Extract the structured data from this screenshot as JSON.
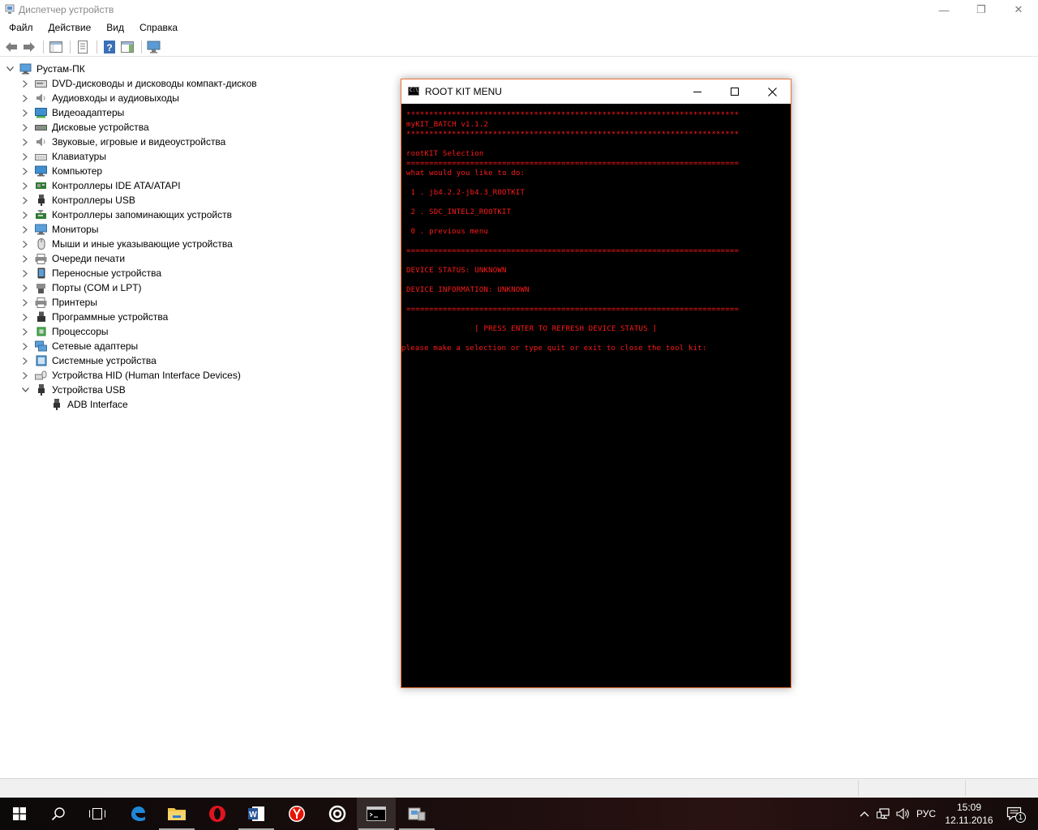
{
  "window": {
    "title": "Диспетчер устройств",
    "caption_min": "—",
    "caption_max": "❐",
    "caption_close": "✕"
  },
  "menu": [
    "Файл",
    "Действие",
    "Вид",
    "Справка"
  ],
  "tree": {
    "root": "Рустам-ПК",
    "items": [
      {
        "label": "DVD-дисководы и дисководы компакт-дисков",
        "icon": "dvd-drive-icon"
      },
      {
        "label": "Аудиовходы и аудиовыходы",
        "icon": "speaker-icon"
      },
      {
        "label": "Видеоадаптеры",
        "icon": "display-adapter-icon"
      },
      {
        "label": "Дисковые устройства",
        "icon": "disk-drive-icon"
      },
      {
        "label": "Звуковые, игровые и видеоустройства",
        "icon": "speaker-icon"
      },
      {
        "label": "Клавиатуры",
        "icon": "keyboard-icon"
      },
      {
        "label": "Компьютер",
        "icon": "computer-icon"
      },
      {
        "label": "Контроллеры IDE ATA/ATAPI",
        "icon": "ide-controller-icon"
      },
      {
        "label": "Контроллеры USB",
        "icon": "usb-plug-icon"
      },
      {
        "label": "Контроллеры запоминающих устройств",
        "icon": "storage-controller-icon"
      },
      {
        "label": "Мониторы",
        "icon": "monitor-icon"
      },
      {
        "label": "Мыши и иные указывающие устройства",
        "icon": "mouse-icon"
      },
      {
        "label": "Очереди печати",
        "icon": "printer-icon"
      },
      {
        "label": "Переносные устройства",
        "icon": "portable-device-icon"
      },
      {
        "label": "Порты (COM и LPT)",
        "icon": "port-icon"
      },
      {
        "label": "Принтеры",
        "icon": "printer-icon"
      },
      {
        "label": "Программные устройства",
        "icon": "software-device-icon"
      },
      {
        "label": "Процессоры",
        "icon": "processor-icon"
      },
      {
        "label": "Сетевые адаптеры",
        "icon": "network-adapter-icon"
      },
      {
        "label": "Системные устройства",
        "icon": "system-device-icon"
      },
      {
        "label": "Устройства HID (Human Interface Devices)",
        "icon": "hid-icon"
      },
      {
        "label": "Устройства USB",
        "icon": "usb-plug-icon",
        "expanded": true
      }
    ],
    "child": {
      "label": "ADB Interface",
      "icon": "usb-plug-icon"
    }
  },
  "console": {
    "title": "ROOT KIT MENU",
    "text_color": "#ff1a1a",
    "lines": [
      "*************************************************************************",
      "myKIT_BATCH v1.1.2",
      "*************************************************************************",
      "",
      "rootKIT Selection",
      "=========================================================================",
      "what would you like to do:",
      "",
      " 1 . jb4.2.2-jb4.3_ROOTKIT",
      "",
      " 2 . SDC_INTEL2_ROOTKIT",
      "",
      " 0 . previous menu",
      "",
      "=========================================================================",
      "",
      "DEVICE STATUS: UNKNOWN",
      "",
      "DEVICE INFORMATION: UNKNOWN",
      "",
      "=========================================================================",
      "",
      "               [ PRESS ENTER TO REFRESH DEVICE STATUS ]",
      "",
      "please make a selection or type quit or exit to close the tool kit:"
    ]
  },
  "taskbar": {
    "language": "РУС",
    "time": "15:09",
    "date": "12.11.2016",
    "notification_count": "1"
  }
}
